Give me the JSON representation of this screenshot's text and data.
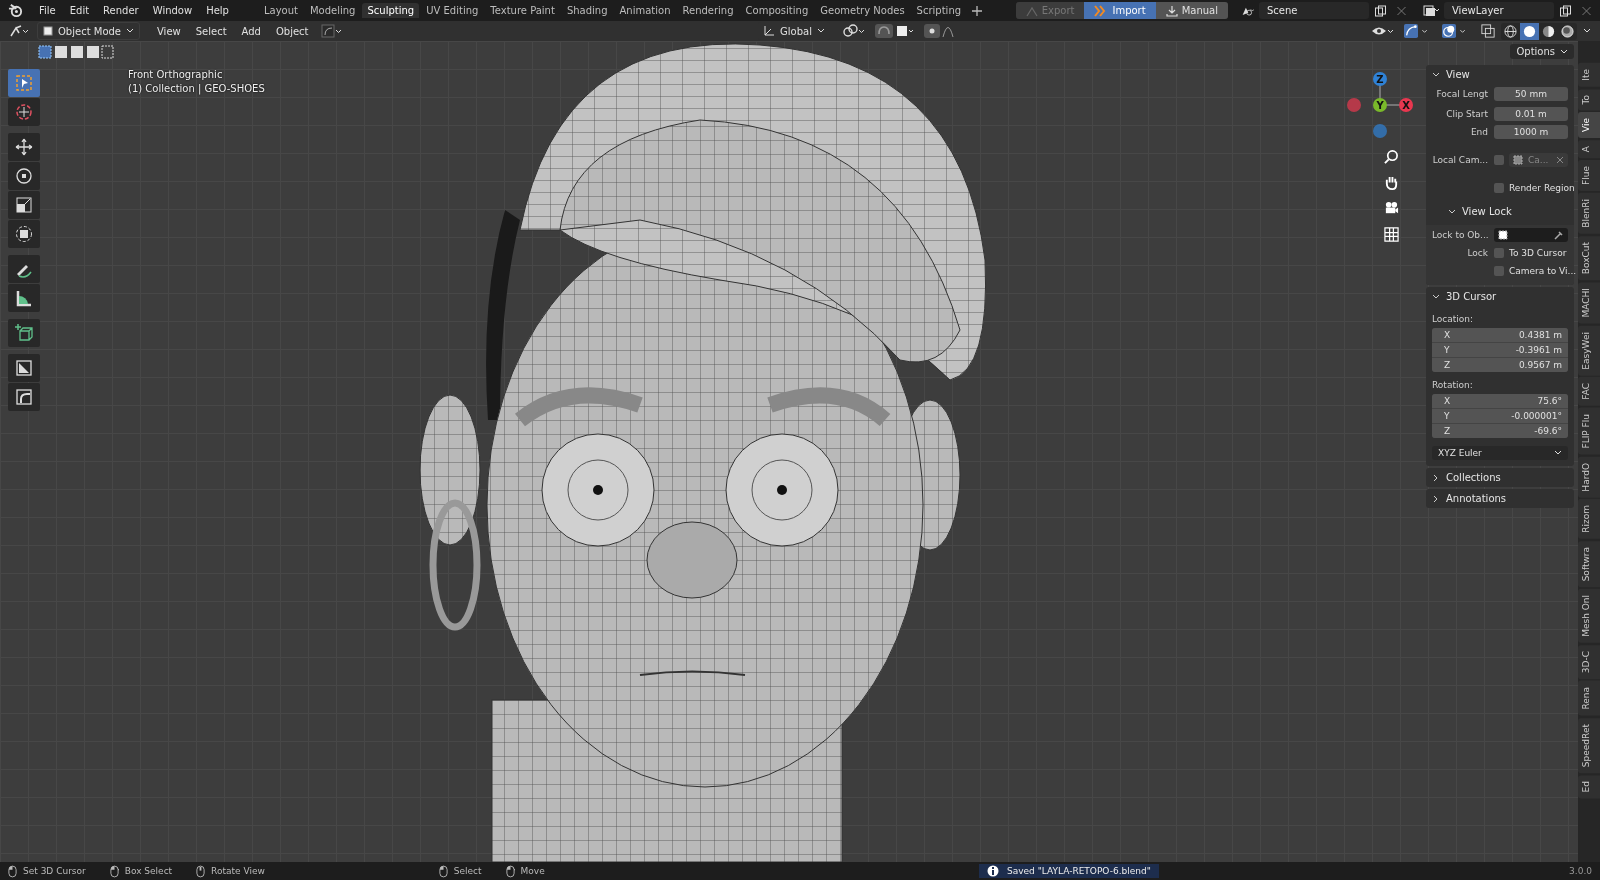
{
  "menu": [
    "File",
    "Edit",
    "Render",
    "Window",
    "Help"
  ],
  "workspaces": [
    {
      "label": "Layout",
      "selected": false
    },
    {
      "label": "Modeling",
      "selected": false
    },
    {
      "label": "Sculpting",
      "selected": true
    },
    {
      "label": "UV Editing",
      "selected": false
    },
    {
      "label": "Texture Paint",
      "selected": false
    },
    {
      "label": "Shading",
      "selected": false
    },
    {
      "label": "Animation",
      "selected": false
    },
    {
      "label": "Rendering",
      "selected": false
    },
    {
      "label": "Compositing",
      "selected": false
    },
    {
      "label": "Geometry Nodes",
      "selected": false
    },
    {
      "label": "Scripting",
      "selected": false
    }
  ],
  "addon_buttons": [
    {
      "kind": "export",
      "label": "Export",
      "disabled": true,
      "active": false
    },
    {
      "kind": "import",
      "label": "Import",
      "disabled": false,
      "active": true
    },
    {
      "kind": "manual",
      "label": "Manual",
      "disabled": false,
      "active": false
    }
  ],
  "scene": {
    "value": "Scene"
  },
  "view_layer": {
    "value": "ViewLayer"
  },
  "header": {
    "mode": "Object Mode",
    "menus": [
      "View",
      "Select",
      "Add",
      "Object"
    ],
    "orientation": "Global",
    "options": "Options"
  },
  "shading_modes": [
    {
      "kind": "wireframe",
      "selected": false
    },
    {
      "kind": "solid",
      "selected": true
    },
    {
      "kind": "material",
      "selected": false
    },
    {
      "kind": "rendered",
      "selected": false
    }
  ],
  "viewport": {
    "view_name": "Front Orthographic",
    "collection": "(1) Collection | GEO-SHOES",
    "gizmo_axes": [
      {
        "kind": "z",
        "label": "Z"
      },
      {
        "kind": "y",
        "label": "Y"
      },
      {
        "kind": "x",
        "label": "X"
      }
    ]
  },
  "tools": [
    {
      "kind": "select",
      "selected": true
    },
    {
      "kind": "cursor",
      "selected": false
    },
    {
      "kind": "move",
      "selected": false
    },
    {
      "kind": "rotate",
      "selected": false
    },
    {
      "kind": "scale",
      "selected": false
    },
    {
      "kind": "transform",
      "selected": false
    },
    {
      "kind": "annotate",
      "selected": false
    },
    {
      "kind": "measure",
      "selected": false
    },
    {
      "kind": "add-cube",
      "selected": false
    },
    {
      "kind": "shrink",
      "selected": false
    },
    {
      "kind": "shear",
      "selected": false
    }
  ],
  "view_panel": {
    "title": "View",
    "expanded": true,
    "fields": [
      {
        "label": "Focal Lengt",
        "value": "50 mm"
      },
      {
        "label": "Clip Start",
        "value": "0.01 m"
      },
      {
        "label": "End",
        "value": "1000 m"
      }
    ],
    "local_camera": {
      "label": "Local Cam...",
      "checked": false,
      "value": "Ca..."
    },
    "render_region": {
      "label": "Render Region",
      "checked": false
    },
    "view_lock": {
      "title": "View Lock",
      "expanded": true,
      "lock_to_object": "Lock to Ob...",
      "lock_label": "Lock",
      "checks": [
        {
          "label": "To 3D Cursor",
          "checked": false
        },
        {
          "label": "Camera to Vi...",
          "checked": false
        }
      ]
    }
  },
  "cursor_panel": {
    "title": "3D Cursor",
    "expanded": true,
    "location_label": "Location:",
    "location": [
      {
        "axis": "X",
        "value": "0.4381 m"
      },
      {
        "axis": "Y",
        "value": "-0.3961 m"
      },
      {
        "axis": "Z",
        "value": "0.9567 m"
      }
    ],
    "rotation_label": "Rotation:",
    "rotation": [
      {
        "axis": "X",
        "value": "75.6°"
      },
      {
        "axis": "Y",
        "value": "-0.000001°"
      },
      {
        "axis": "Z",
        "value": "-69.6°"
      }
    ],
    "rotation_mode": "XYZ Euler"
  },
  "collapsed_panels": [
    {
      "title": "Collections",
      "expanded": false
    },
    {
      "title": "Annotations",
      "expanded": false
    }
  ],
  "side_tabs": [
    {
      "label": "Ite",
      "selected": false
    },
    {
      "label": "To",
      "selected": false
    },
    {
      "label": "Vie",
      "selected": true
    },
    {
      "label": "A",
      "selected": false
    },
    {
      "label": "Flue",
      "selected": false
    },
    {
      "label": "BlenRi",
      "selected": false
    },
    {
      "label": "BoxCut",
      "selected": false
    },
    {
      "label": "MACHI",
      "selected": false
    },
    {
      "label": "EasyWei",
      "selected": false
    },
    {
      "label": "FAC",
      "selected": false
    },
    {
      "label": "FLIP Flu",
      "selected": false
    },
    {
      "label": "HardO",
      "selected": false
    },
    {
      "label": "Rizom",
      "selected": false
    },
    {
      "label": "Softwra",
      "selected": false
    },
    {
      "label": "Mesh Onl",
      "selected": false
    },
    {
      "label": "3D-C",
      "selected": false
    },
    {
      "label": "Rena",
      "selected": false
    },
    {
      "label": "SpeedRet",
      "selected": false
    },
    {
      "label": "Ed",
      "selected": false
    }
  ],
  "status_bar": {
    "hints": [
      {
        "kind": "left",
        "label": "Set 3D Cursor"
      },
      {
        "kind": "drag",
        "label": "Box Select"
      },
      {
        "kind": "middle",
        "label": "Rotate View"
      },
      {
        "kind": "left",
        "label": "Select"
      },
      {
        "kind": "drag",
        "label": "Move"
      }
    ],
    "message": "Saved \"LAYLA-RETOPO-6.blend\"",
    "version": "3.0.0"
  }
}
